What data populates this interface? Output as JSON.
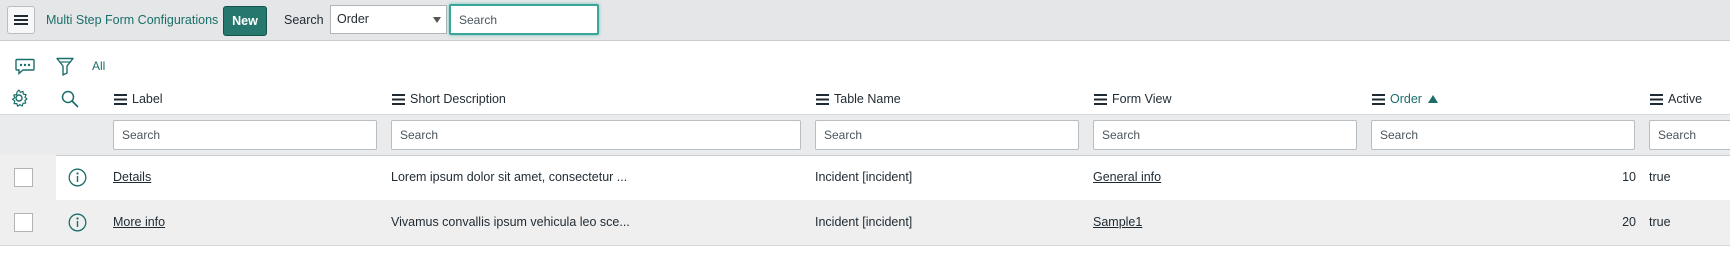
{
  "header": {
    "title": "Multi Step Form Configurations",
    "new_label": "New",
    "search_label": "Search",
    "search_field_selected": "Order",
    "search_placeholder": "Search"
  },
  "toolbar": {
    "filter_all_label": "All",
    "icons": [
      "comments-icon",
      "funnel-icon",
      "gear-icon",
      "search-icon"
    ]
  },
  "columns": [
    {
      "key": "label",
      "label": "Label",
      "sorted": false
    },
    {
      "key": "short_description",
      "label": "Short Description",
      "sorted": false
    },
    {
      "key": "table_name",
      "label": "Table Name",
      "sorted": false
    },
    {
      "key": "form_view",
      "label": "Form View",
      "sorted": false
    },
    {
      "key": "order",
      "label": "Order",
      "sorted": true,
      "sort_direction": "ascending"
    },
    {
      "key": "active",
      "label": "Active",
      "sorted": false
    }
  ],
  "filter_placeholder": "Search",
  "rows": [
    {
      "label": "Details",
      "short_description": "Lorem ipsum dolor sit amet, consectetur ...",
      "table_name": "Incident [incident]",
      "form_view": "General info",
      "order": "10",
      "active": "true"
    },
    {
      "label": "More info",
      "short_description": "Vivamus convallis ipsum vehicula leo sce...",
      "table_name": "Incident [incident]",
      "form_view": "Sample1",
      "order": "20",
      "active": "true"
    }
  ],
  "colors": {
    "accent": "#1a6e6a",
    "new_button": "#26786f",
    "topbar": "#e4e6e7"
  }
}
